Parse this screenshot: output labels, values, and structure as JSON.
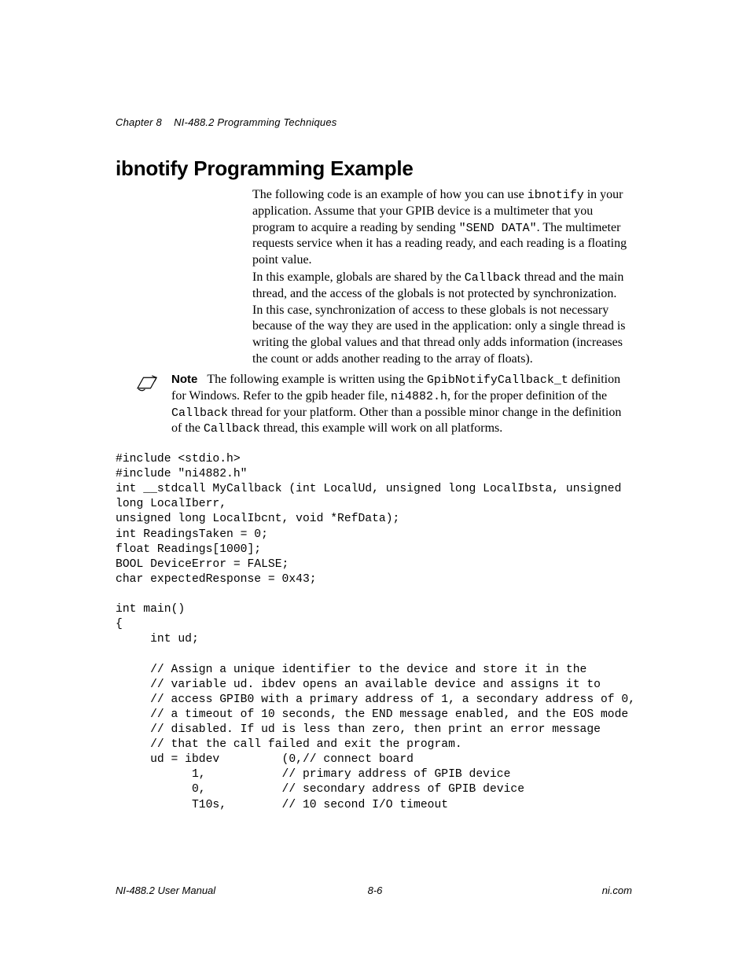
{
  "header": {
    "chapter": "Chapter 8",
    "title": "NI-488.2 Programming Techniques"
  },
  "section": {
    "title": "ibnotify Programming Example"
  },
  "body": {
    "p1_a": "The following code is an example of how you can use ",
    "p1_code1": "ibnotify",
    "p1_b": " in your application. Assume that your GPIB device is a multimeter that you program to acquire a reading by sending ",
    "p1_code2": "\"SEND DATA\"",
    "p1_c": ". The multimeter requests service when it has a reading ready, and each reading is a floating point value.",
    "p2_a": "In this example, globals are shared by the ",
    "p2_code1": "Callback",
    "p2_b": " thread and the main thread, and the access of the globals is not protected by synchronization. In this case, synchronization of access to these globals is not necessary because of the way they are used in the application: only a single thread is writing the global values and that thread only adds information (increases the count or adds another reading to the array of floats)."
  },
  "note": {
    "label": "Note",
    "a": "The following example is written using the ",
    "code1": "GpibNotifyCallback_t",
    "b": " definition for Windows. Refer to the gpib header file, ",
    "code2": "ni4882.h",
    "c": ", for the proper definition of the ",
    "code3": "Callback",
    "d": " thread for your platform. Other than a possible minor change in the definition of the ",
    "code4": "Callback",
    "e": " thread, this example will work on all platforms."
  },
  "code": "#include <stdio.h>\n#include \"ni4882.h\"\nint __stdcall MyCallback (int LocalUd, unsigned long LocalIbsta, unsigned \nlong LocalIberr,\nunsigned long LocalIbcnt, void *RefData);\nint ReadingsTaken = 0;\nfloat Readings[1000];\nBOOL DeviceError = FALSE;\nchar expectedResponse = 0x43;\n\nint main() \n{\n     int ud;\n\n     // Assign a unique identifier to the device and store it in the\n     // variable ud. ibdev opens an available device and assigns it to\n     // access GPIB0 with a primary address of 1, a secondary address of 0,\n     // a timeout of 10 seconds, the END message enabled, and the EOS mode\n     // disabled. If ud is less than zero, then print an error message\n     // that the call failed and exit the program.\n     ud = ibdev         (0,// connect board\n           1,           // primary address of GPIB device\n           0,           // secondary address of GPIB device\n           T10s,        // 10 second I/O timeout",
  "footer": {
    "left": "NI-488.2 User Manual",
    "center": "8-6",
    "right": "ni.com"
  }
}
